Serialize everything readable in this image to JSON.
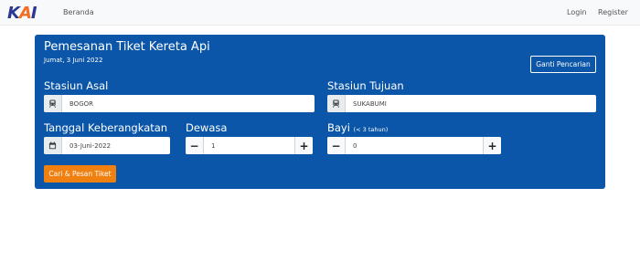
{
  "navbar": {
    "logo_text": "KAI",
    "links": {
      "beranda": "Beranda",
      "login": "Login",
      "register": "Register"
    }
  },
  "booking": {
    "title": "Pemesanan Tiket Kereta Api",
    "date": "Jumat, 3 Juni 2022",
    "change_search_label": "Ganti Pencarian",
    "origin": {
      "label": "Stasiun Asal",
      "value": "BOGOR",
      "icon": "train-icon"
    },
    "destination": {
      "label": "Stasiun Tujuan",
      "value": "SUKABUMI",
      "icon": "train-icon"
    },
    "departure": {
      "label": "Tanggal Keberangkatan",
      "value": "03-Juni-2022",
      "icon": "calendar-icon"
    },
    "adult": {
      "label": "Dewasa",
      "value": "1"
    },
    "infant": {
      "label": "Bayi",
      "note": "(< 3 tahun)",
      "value": "0"
    },
    "submit_label": "Cari & Pesan Tiket"
  },
  "colors": {
    "panel": "#0b56a8",
    "accent_button": "#f0800f",
    "logo_blue": "#2b3990",
    "logo_orange": "#f26f21"
  }
}
